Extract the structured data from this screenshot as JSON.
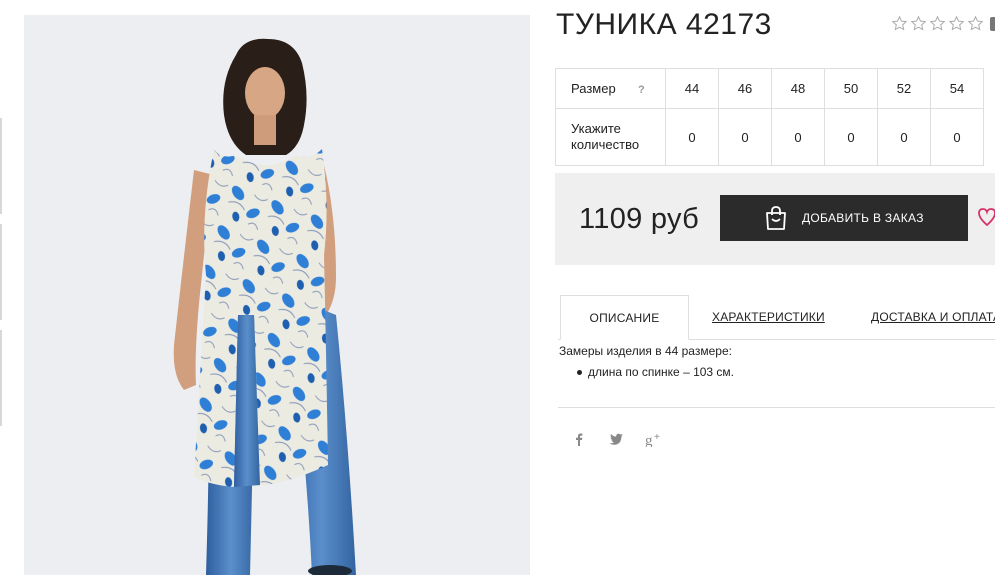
{
  "product": {
    "title": "ТУНИКА 42173",
    "rating_max": 5,
    "rating_value": 0
  },
  "size_table": {
    "size_label": "Размер",
    "help_symbol": "?",
    "sizes": [
      "44",
      "46",
      "48",
      "50",
      "52",
      "54"
    ],
    "quantity_label": "Укажите количество",
    "quantities": [
      "0",
      "0",
      "0",
      "0",
      "0",
      "0"
    ]
  },
  "purchase": {
    "price": "1109 руб",
    "add_button_label": "ДОБАВИТЬ В ЗАКАЗ"
  },
  "tabs": [
    {
      "label": "ОПИСАНИЕ",
      "active": true
    },
    {
      "label": "ХАРАКТЕРИСТИКИ",
      "active": false
    },
    {
      "label": "ДОСТАВКА И ОПЛАТА",
      "active": false
    }
  ],
  "description": {
    "intro": "Замеры изделия в 44 размере:",
    "items": [
      "длина по спинке – 103 см."
    ]
  },
  "social": {
    "icons": [
      "facebook-icon",
      "twitter-icon",
      "google-plus-icon"
    ]
  },
  "colors": {
    "button_bg": "#2b2b2b",
    "price_bg": "#efefef",
    "heart": "#d6336c",
    "print_blue": "#2f7fd6",
    "print_base": "#ecebe2",
    "jeans": "#3d6fb0"
  }
}
